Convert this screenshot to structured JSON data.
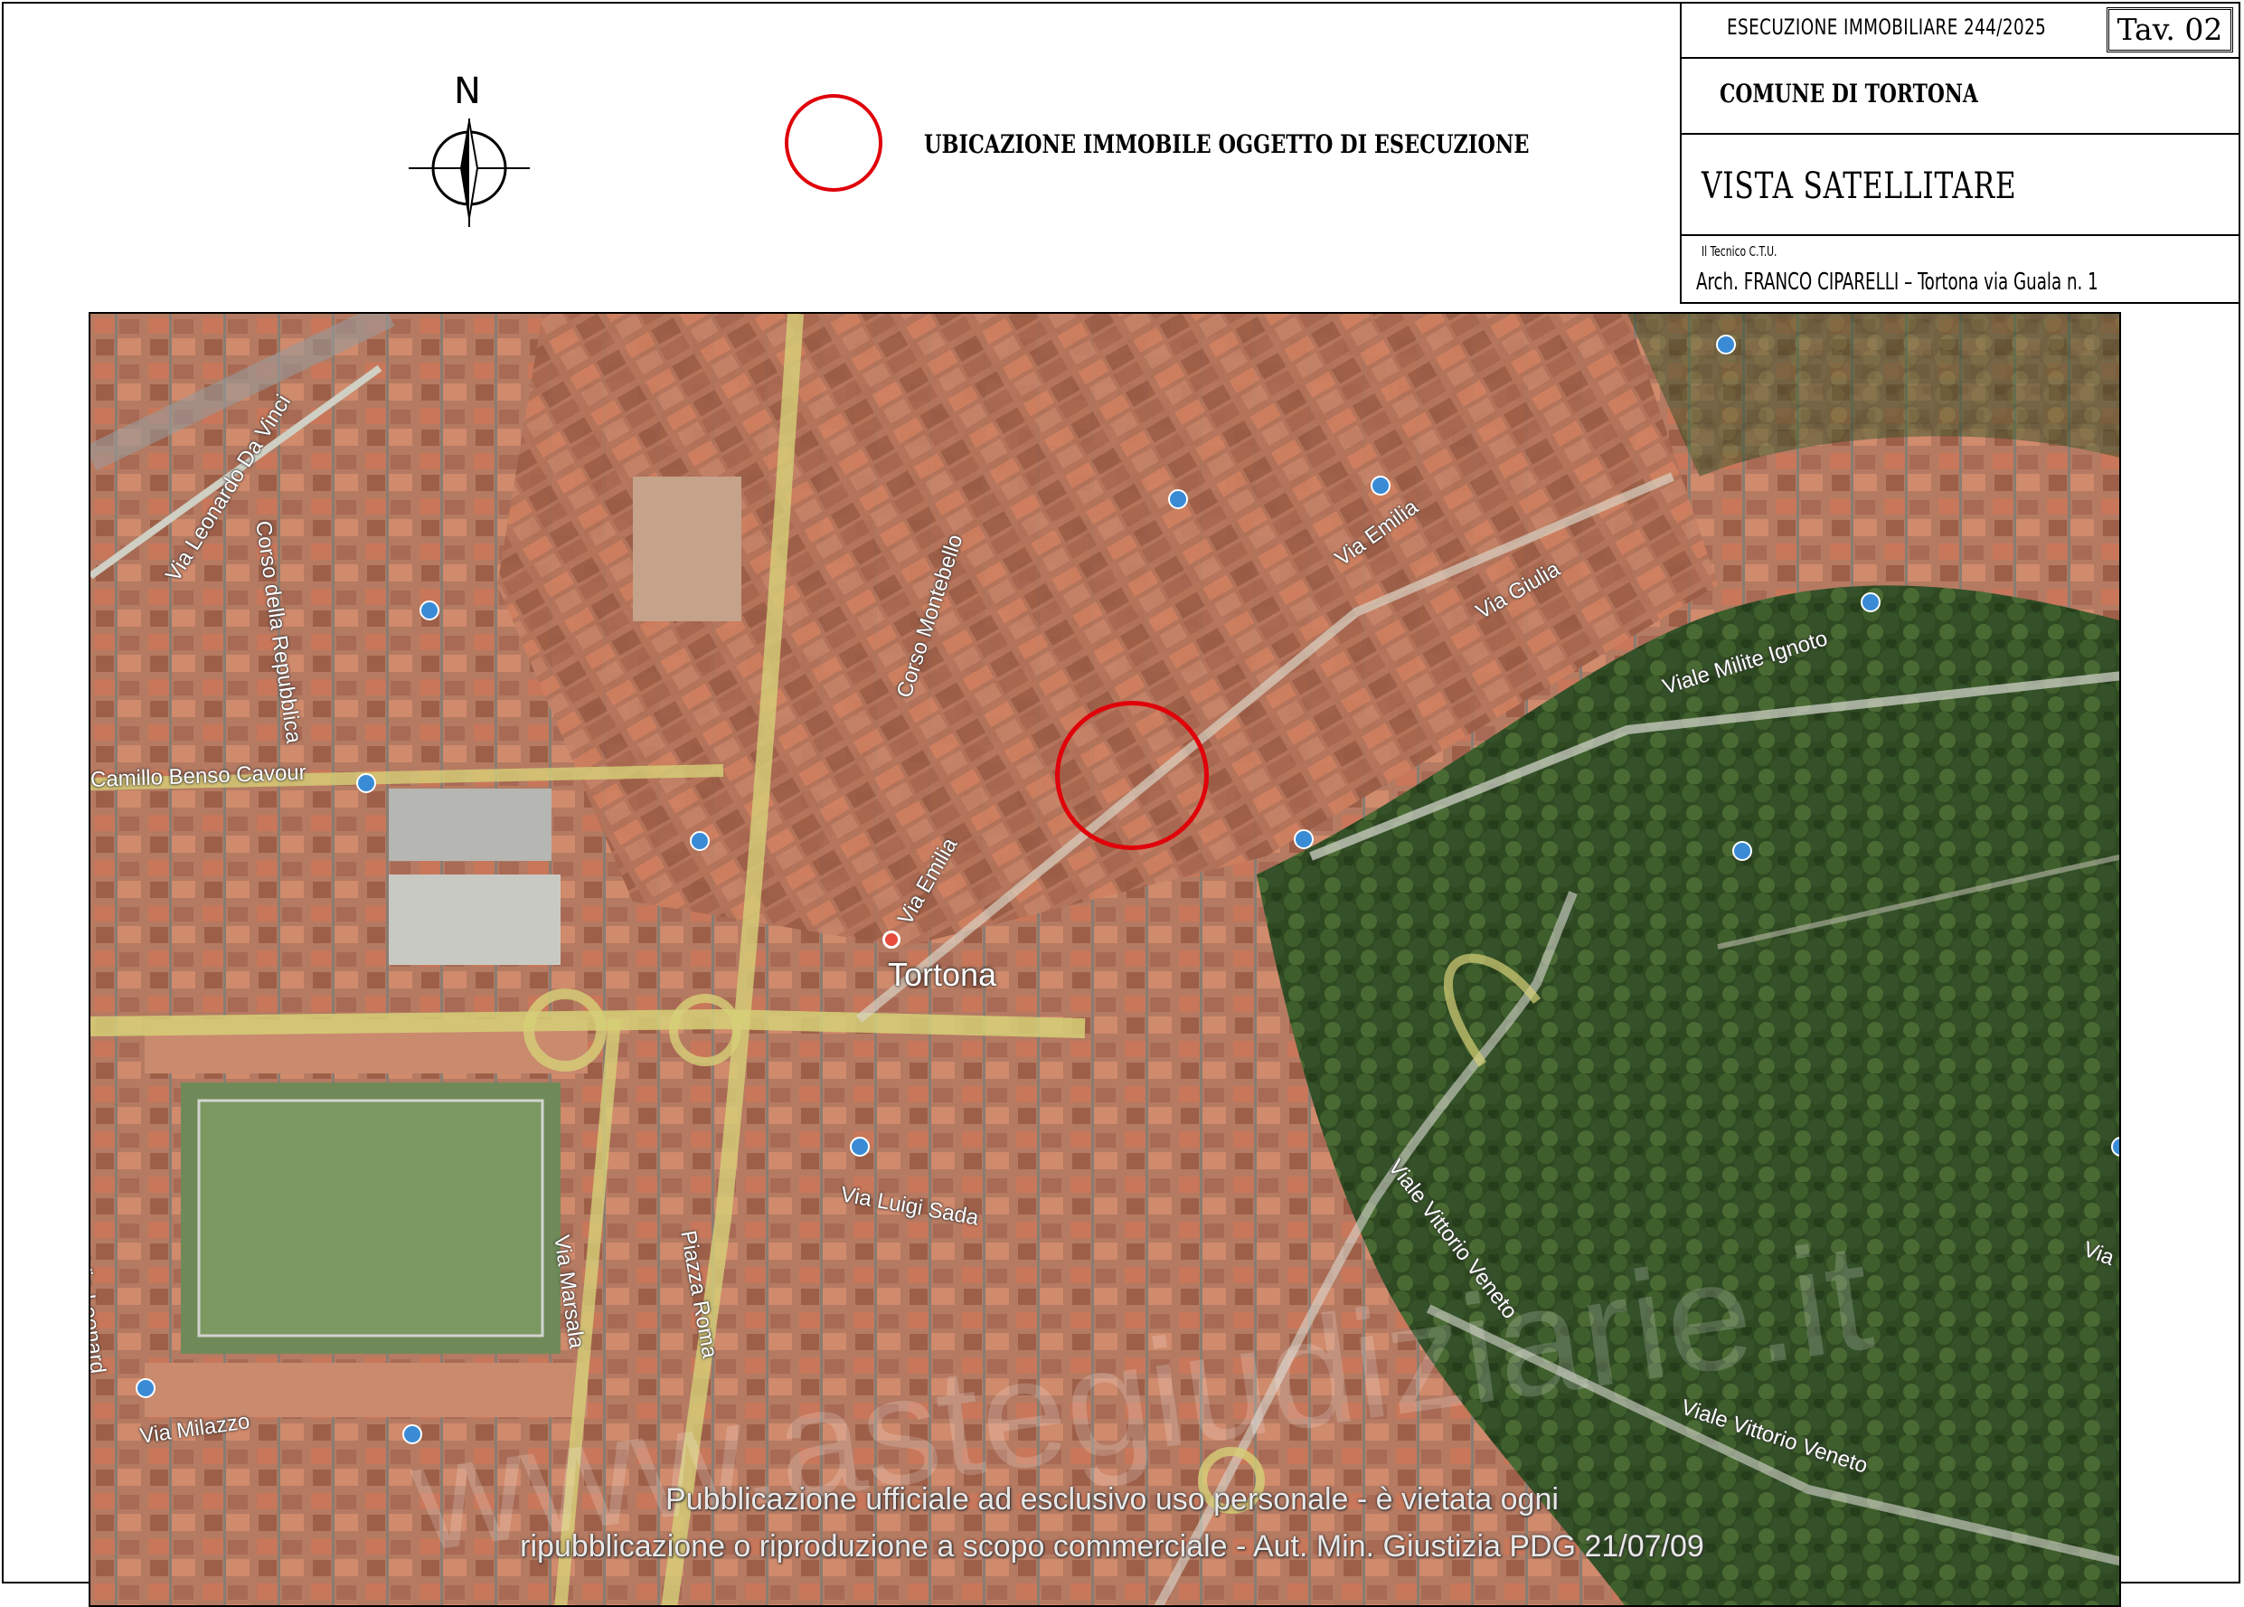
{
  "title_block": {
    "execution": "ESECUZIONE IMMOBILIARE 244/2025",
    "table_number": "Tav. 02",
    "municipality": "COMUNE DI TORTONA",
    "view_title": "VISTA SATELLITARE",
    "technician_label": "Il Tecnico C.T.U.",
    "technician": "Arch. FRANCO CIPARELLI – Tortona via Guala n. 1"
  },
  "legend": {
    "north_label": "N",
    "marker_label": "UBICAZIONE IMMOBILE OGGETTO DI ESECUZIONE",
    "marker_color": "#e0000a"
  },
  "map": {
    "city_label": "Tortona",
    "streets": {
      "leonardo": "Via Leonardo Da Vinci",
      "repubblica": "Corso della Repubblica",
      "cavour": "Camillo Benso Cavour",
      "montebello": "Corso Montebello",
      "emilia1": "Via Emilia",
      "emilia2": "Via Emilia",
      "giulia": "Via Giulia",
      "milite": "Viale Milite Ignoto",
      "marsala": "Via Marsala",
      "piazza_roma": "Piazza Roma",
      "luigi_sada": "Via Luigi Sada",
      "leonardo2": "Via Leonard",
      "milazzo": "Via Milazzo",
      "veneto1": "Viale Vittorio Veneto",
      "veneto2": "Viale Vittorio Veneto",
      "via_right": "Via"
    },
    "disclaimer_line1": "Pubblicazione ufficiale ad esclusivo uso personale - è vietata ogni",
    "disclaimer_line2": "ripubblicazione o riproduzione a scopo commerciale - Aut. Min. Giustizia PDG 21/07/09",
    "watermark": "www.astegiudiziarie.it"
  }
}
